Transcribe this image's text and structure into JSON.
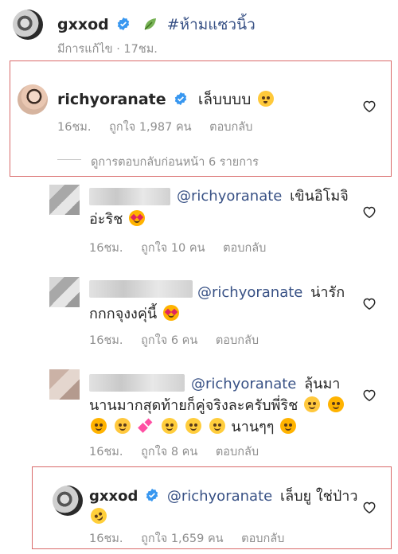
{
  "post": {
    "username": "gxxod",
    "hashtag": "#ห้ามแซวนิ้ว",
    "edited": "มีการแก้ไข · 17ชม."
  },
  "comments": [
    {
      "username": "richyoranate",
      "text": "เล็บบบบ",
      "emoji": [
        "kissing-face"
      ],
      "time": "16ชม.",
      "likes": "ถูกใจ 1,987 คน",
      "reply": "ตอบกลับ",
      "view_replies": "ดูการตอบกลับก่อนหน้า 6 รายการ"
    }
  ],
  "replies": [
    {
      "mention": "@richyoranate",
      "text_line1": "เขินอิโมจิ",
      "text_line2": "อ่ะริช",
      "emoji": [
        "heart-eyes-face"
      ],
      "time": "16ชม.",
      "likes": "ถูกใจ 10 คน",
      "reply": "ตอบกลับ"
    },
    {
      "mention": "@richyoranate",
      "text_line1": "น่ารัก",
      "text_line2": "กกกจุงงคุ่นี้",
      "emoji": [
        "heart-eyes-face"
      ],
      "time": "16ชม.",
      "likes": "ถูกใจ 6 คน",
      "reply": "ตอบกลับ"
    },
    {
      "mention": "@richyoranate",
      "text_line1": "ลุ้นมา",
      "text_line2": "นานมากสุดท้ายก็คู่จริงละครับพี่ริช",
      "text_line3": "นานๆๆ",
      "emoji": [
        "hugging-face",
        "smiling-face-with-hearts",
        "two-hearts",
        "smiling-face",
        "smiling-face",
        "smiling-face",
        "smiling-face-with-hearts"
      ],
      "time": "16ชม.",
      "likes": "ถูกใจ 8 คน",
      "reply": "ตอบกลับ"
    },
    {
      "username": "gxxod",
      "mention": "@richyoranate",
      "text_line1": "เล็บยู ใช่ป่าว",
      "emoji": [
        "rolling-laughing-face"
      ],
      "time": "16ชม.",
      "likes": "ถูกใจ 1,659 คน",
      "reply": "ตอบกลับ"
    }
  ],
  "colors": {
    "highlight_box": "#d96a6a",
    "mention": "#385185",
    "meta": "#8e8e8e",
    "verified": "#3897f0"
  }
}
